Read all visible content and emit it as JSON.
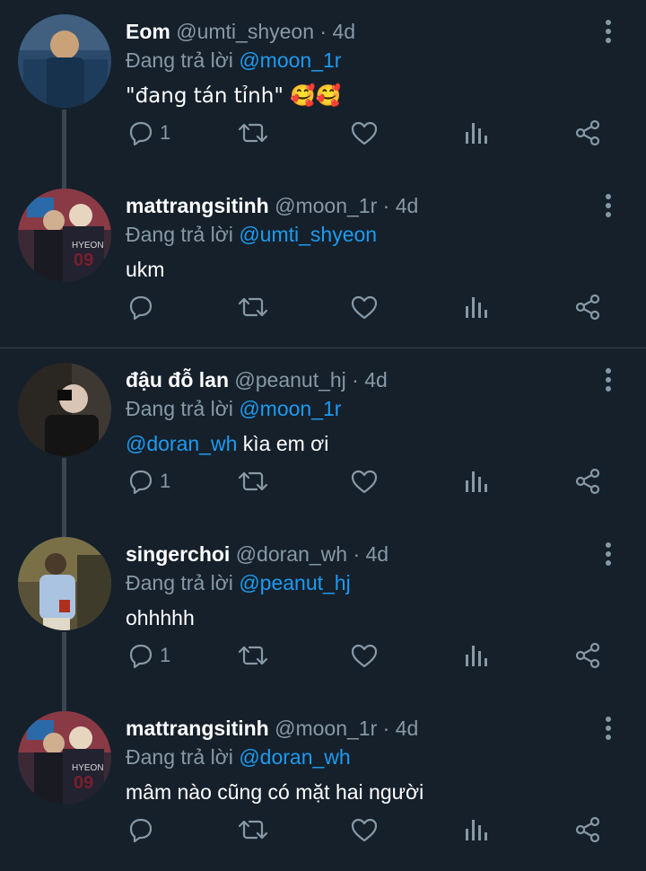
{
  "replying_prefix": "Đang trả lời",
  "tweets": [
    {
      "name": "Eom",
      "handle": "@umti_shyeon",
      "time": "· 4d",
      "reply_to": "@moon_1r",
      "text": "\"đang tán tỉnh\" 🥰🥰",
      "reply_count": "1"
    },
    {
      "name": "mattrangsitinh",
      "handle": "@moon_1r",
      "time": "· 4d",
      "reply_to": "@umti_shyeon",
      "text": "ukm",
      "reply_count": ""
    },
    {
      "name": "đậu đỗ lan",
      "handle": "@peanut_hj",
      "time": "· 4d",
      "reply_to": "@moon_1r",
      "text_mention": "@doran_wh",
      "text": " kìa em ơi",
      "reply_count": "1"
    },
    {
      "name": "singerchoi",
      "handle": "@doran_wh",
      "time": "· 4d",
      "reply_to": "@peanut_hj",
      "text": "ohhhhh",
      "reply_count": "1"
    },
    {
      "name": "mattrangsitinh",
      "handle": "@moon_1r",
      "time": "· 4d",
      "reply_to": "@doran_wh",
      "text": "mâm nào cũng có mặt hai người",
      "reply_count": ""
    }
  ],
  "icons": [
    "reply-icon",
    "retweet-icon",
    "like-icon",
    "analytics-icon",
    "share-icon",
    "more-icon"
  ],
  "colors": {
    "background": "#15202b",
    "mention": "#1d9bf0",
    "muted": "#8899a6",
    "thread_line": "#3a4652"
  }
}
